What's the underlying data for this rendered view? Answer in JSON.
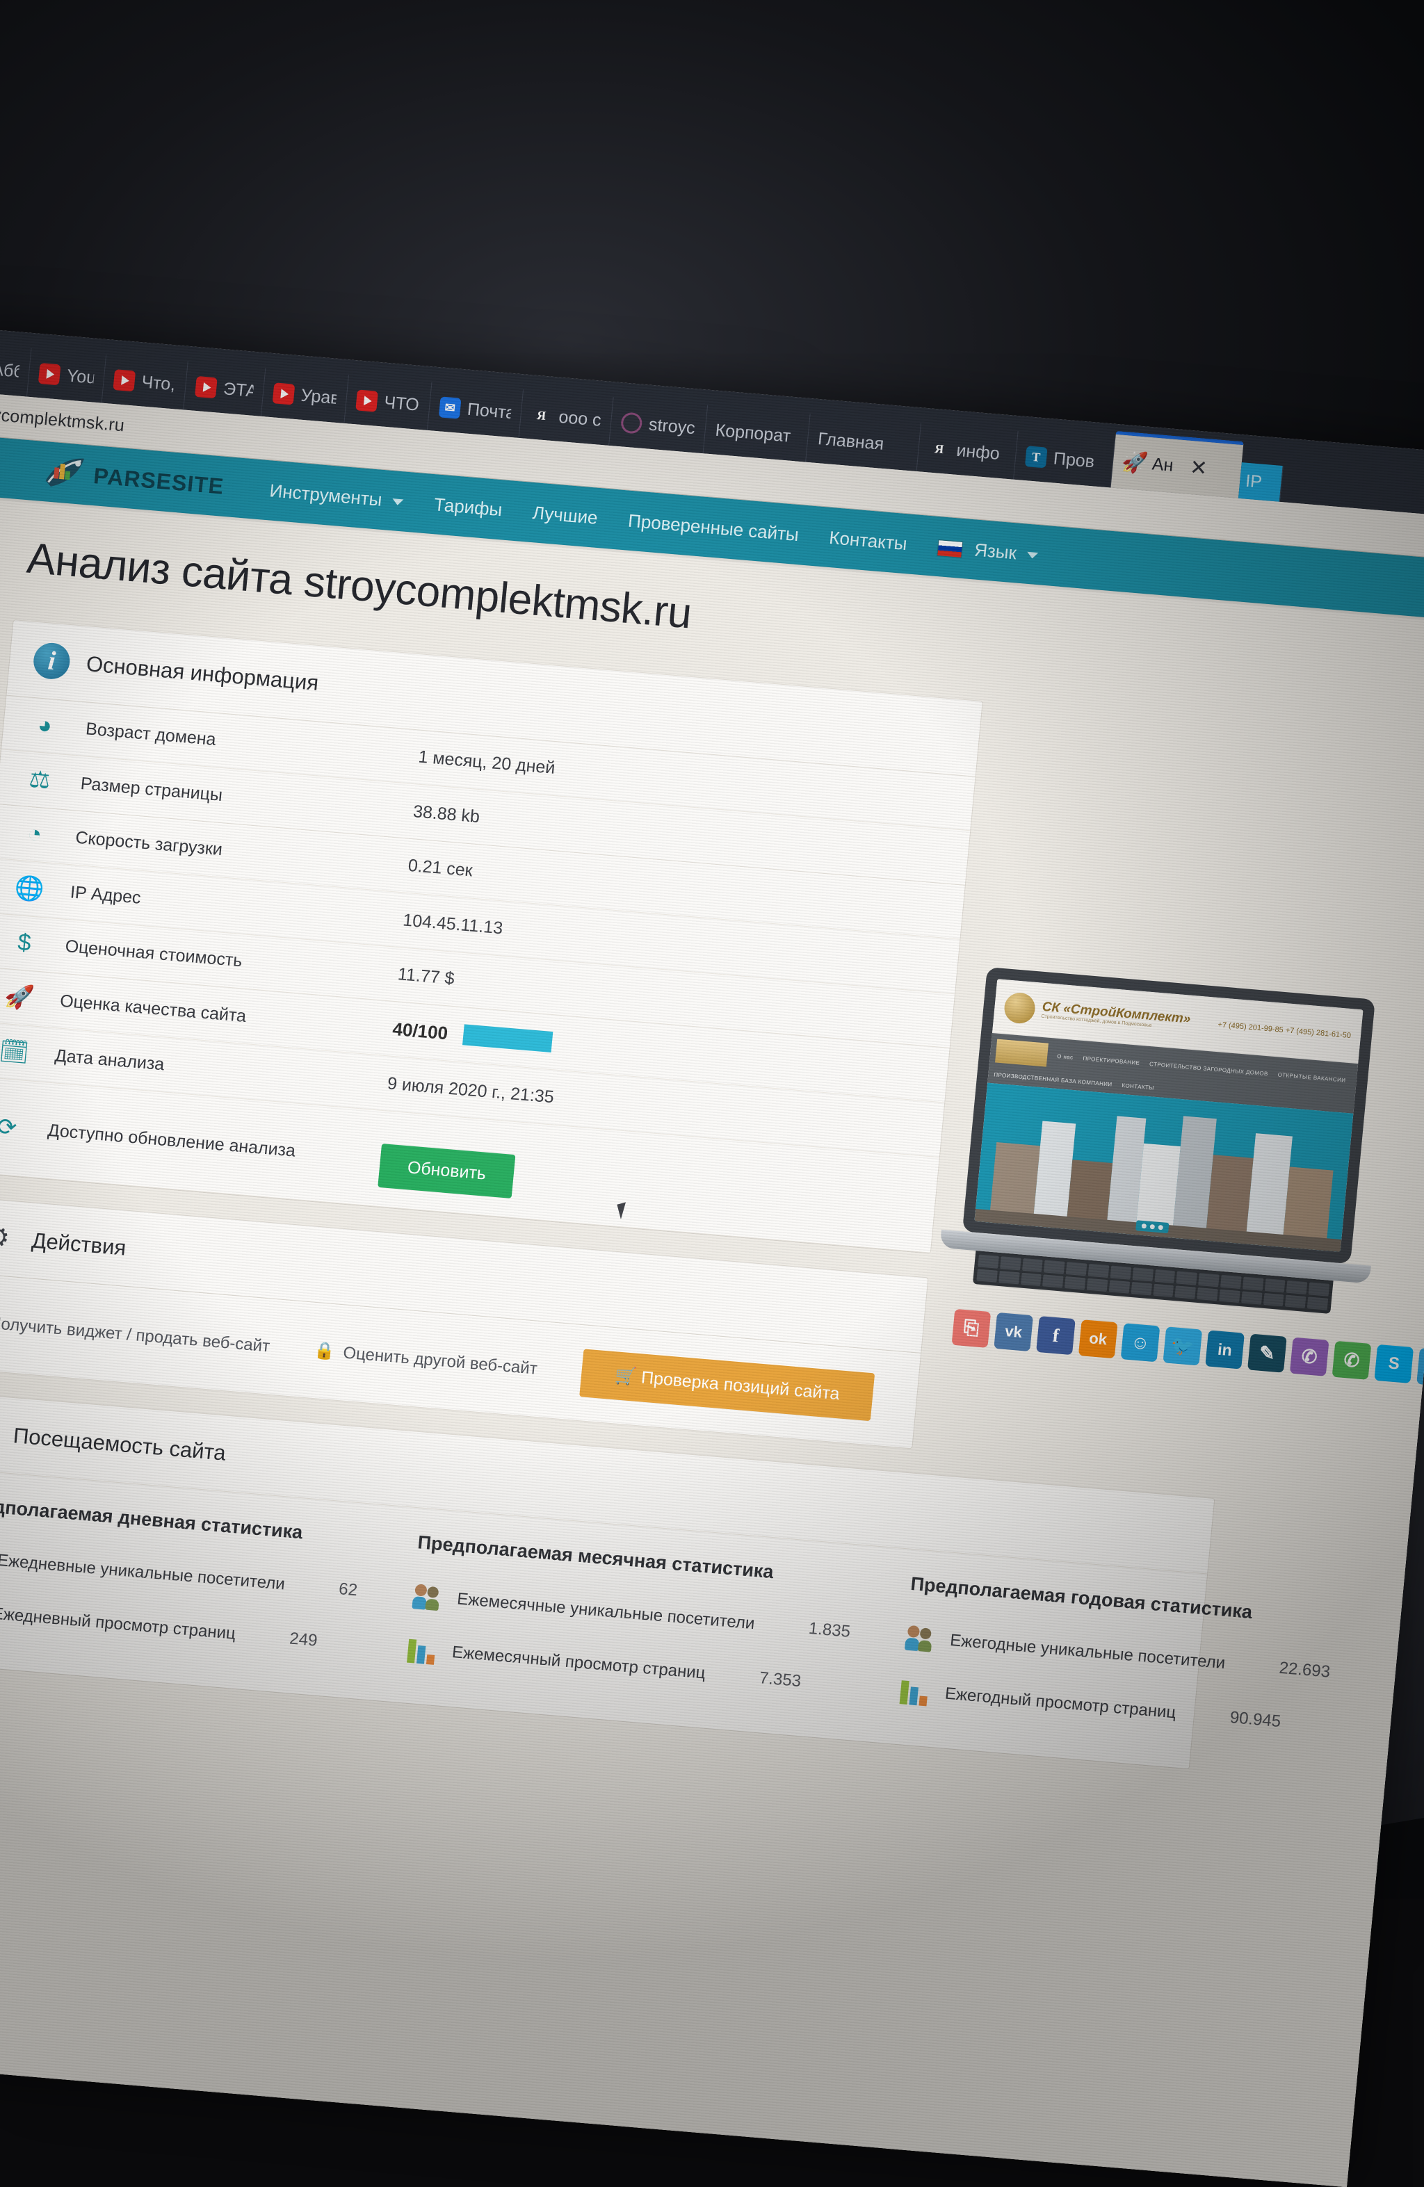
{
  "browser": {
    "url": "t/stroycomplektmsk.ru",
    "tabs": [
      {
        "label": "Аббв",
        "icon": "generic-icon"
      },
      {
        "label": "YouTu",
        "icon": "youtube-icon"
      },
      {
        "label": "Что, е",
        "icon": "youtube-icon"
      },
      {
        "label": "ЭТА ч",
        "icon": "youtube-icon"
      },
      {
        "label": "Уравн",
        "icon": "youtube-icon"
      },
      {
        "label": "ЧТО с",
        "icon": "youtube-icon"
      },
      {
        "label": "Почта",
        "icon": "mail-icon"
      },
      {
        "label": "ооо с",
        "icon": "yandex-icon"
      },
      {
        "label": "stroyc",
        "icon": "globe-icon"
      },
      {
        "label": "Корпорат",
        "icon": "none"
      },
      {
        "label": "Главная",
        "icon": "none"
      },
      {
        "label": "инфо",
        "icon": "yandex-icon"
      },
      {
        "label": "Пров",
        "icon": "text-icon"
      }
    ],
    "active_tab": {
      "label": "Ан",
      "icon": "rocket-icon",
      "close": "✕"
    },
    "edge_tab": {
      "label": "IP"
    }
  },
  "nav": {
    "brand": "PARSESITE",
    "items": [
      {
        "label": "Инструменты",
        "caret": true
      },
      {
        "label": "Тарифы",
        "caret": false
      },
      {
        "label": "Лучшие",
        "caret": false
      },
      {
        "label": "Проверенные сайты",
        "caret": false
      },
      {
        "label": "Контакты",
        "caret": false
      }
    ],
    "language": {
      "label": "Язык",
      "flag": "russia-flag"
    }
  },
  "page": {
    "title": "Анализ сайта stroycomplektmsk.ru"
  },
  "basic_info": {
    "heading": "Основная информация",
    "rows": [
      {
        "icon": "clock-icon",
        "label": "Возраст домена",
        "value": "1 месяц, 20 дней"
      },
      {
        "icon": "scales-icon",
        "label": "Размер страницы",
        "value": "38.88 kb"
      },
      {
        "icon": "speedometer-icon",
        "label": "Скорость загрузки",
        "value": "0.21 сек"
      },
      {
        "icon": "globe-icon",
        "label": "IP Адрес",
        "value": "104.45.11.13"
      },
      {
        "icon": "dollar-icon",
        "label": "Оценочная стоимость",
        "value": "11.77 $"
      },
      {
        "icon": "rocket-icon",
        "label": "Оценка качества сайта",
        "value": "40/100"
      },
      {
        "icon": "calendar-check-icon",
        "label": "Дата анализа",
        "value": "9 июля 2020 г., 21:35"
      },
      {
        "icon": "refresh-icon",
        "label": "Доступно обновление анализа",
        "value": ""
      }
    ],
    "quality_score": "40/100",
    "quality_percent": 40,
    "refresh_button": "Обновить"
  },
  "actions": {
    "heading": "Действия",
    "widget_link": "Получить виджет / продать веб-сайт",
    "evaluate_link": "Оценить другой веб-сайт",
    "positions_button": "Проверка позиций сайта"
  },
  "traffic": {
    "heading": "Посещаемость сайта",
    "columns": [
      {
        "title": "Предполагаемая дневная статистика",
        "rows": [
          {
            "icon": "people-icon",
            "label": "Ежедневные уникальные посетители",
            "value": "62"
          },
          {
            "icon": "barchart-icon",
            "label": "Ежедневный просмотр страниц",
            "value": "249"
          }
        ]
      },
      {
        "title": "Предполагаемая месячная статистика",
        "rows": [
          {
            "icon": "people-icon",
            "label": "Ежемесячные уникальные посетители",
            "value": "1.835"
          },
          {
            "icon": "barchart-icon",
            "label": "Ежемесячный просмотр страниц",
            "value": "7.353"
          }
        ]
      },
      {
        "title": "Предполагаемая годовая статистика",
        "rows": [
          {
            "icon": "people-icon",
            "label": "Ежегодные уникальные посетители",
            "value": "22.693"
          },
          {
            "icon": "barchart-icon",
            "label": "Ежегодный просмотр страниц",
            "value": "90.945"
          }
        ]
      }
    ]
  },
  "preview": {
    "site_name": "СК «СтройКомплект»",
    "site_tagline": "Строительство коттеджей, домов в Подмосковье",
    "phone1": "+7 (495) 201-99-85",
    "phone2": "+7 (495) 281-61-50",
    "menu": [
      "О нас",
      "ПРОЕКТИРОВАНИЕ",
      "СТРОИТЕЛЬСТВО ЗАГОРОДНЫХ ДОМОВ",
      "ОТКРЫТЫЕ ВАКАНСИИ",
      "ПРОИЗВОДСТВЕННАЯ БАЗА КОМПАНИИ",
      "КОНТАКТЫ"
    ]
  },
  "socials": [
    {
      "name": "share-icon",
      "glyph": "⎘",
      "color": "#e8716a"
    },
    {
      "name": "vk-icon",
      "glyph": "vk",
      "color": "#4a76a8"
    },
    {
      "name": "facebook-icon",
      "glyph": "f",
      "color": "#3b5998"
    },
    {
      "name": "odnoklassniki-icon",
      "glyph": "ok",
      "color": "#ee8208"
    },
    {
      "name": "moimir-icon",
      "glyph": "☺",
      "color": "#1e9fd8"
    },
    {
      "name": "twitter-icon",
      "glyph": "t",
      "color": "#2daae1"
    },
    {
      "name": "linkedin-icon",
      "glyph": "in",
      "color": "#0e76a8"
    },
    {
      "name": "livejournal-icon",
      "glyph": "✎",
      "color": "#154a5e"
    },
    {
      "name": "viber-icon",
      "glyph": "✆",
      "color": "#8f5db7"
    },
    {
      "name": "whatsapp-icon",
      "glyph": "✆",
      "color": "#4caf50"
    },
    {
      "name": "skype-icon",
      "glyph": "s",
      "color": "#00aff0"
    },
    {
      "name": "telegram-icon",
      "glyph": "➤",
      "color": "#30a3dc"
    }
  ],
  "colors": {
    "nav_teal": "#1a8ca3",
    "green": "#1faa59",
    "orange": "#e8a33a",
    "bar_cyan": "#1fb6d6"
  }
}
